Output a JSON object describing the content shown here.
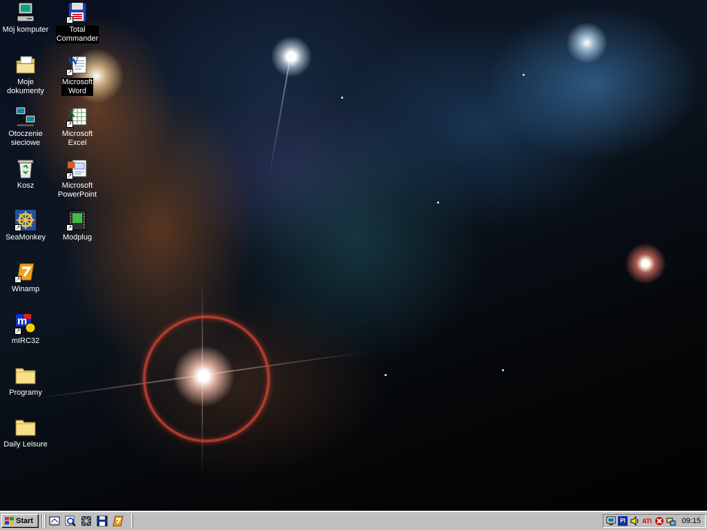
{
  "desktop": {
    "icons": [
      {
        "label": "Mój komputer",
        "icon": "my-computer-icon"
      },
      {
        "label": "Total\nCommander",
        "icon": "total-commander-icon"
      },
      {
        "label": "Moje\ndokumenty",
        "icon": "my-documents-icon"
      },
      {
        "label": "Microsoft\nWord",
        "icon": "word-icon"
      },
      {
        "label": "Otoczenie\nsieciowe",
        "icon": "network-neighborhood-icon"
      },
      {
        "label": "Microsoft\nExcel",
        "icon": "excel-icon"
      },
      {
        "label": "Kosz",
        "icon": "recycle-bin-icon"
      },
      {
        "label": "Microsoft\nPowerPoint",
        "icon": "powerpoint-icon"
      },
      {
        "label": "SeaMonkey",
        "icon": "seamonkey-icon"
      },
      {
        "label": "Modplug",
        "icon": "modplug-icon"
      },
      {
        "label": "Winamp",
        "icon": "winamp-icon"
      },
      {
        "label": "mIRC32",
        "icon": "mirc-icon"
      },
      {
        "label": "Programy",
        "icon": "folder-icon"
      },
      {
        "label": "Daily Leisure",
        "icon": "folder-icon"
      }
    ]
  },
  "taskbar": {
    "start_label": "Start",
    "quick_launch": [
      "show-desktop-icon",
      "explorer-search-icon",
      "channels-icon",
      "save-disk-icon",
      "winamp-icon"
    ],
    "tray": {
      "language": "Pl",
      "clock": "09:15",
      "icons": [
        "display-settings-icon",
        "language-indicator",
        "volume-icon",
        "ati-icon",
        "antivirus-icon",
        "network-icon"
      ]
    }
  },
  "colors": {
    "taskbar": "#c0c0c0",
    "label_text": "#ffffff",
    "label_background": "#000000"
  }
}
